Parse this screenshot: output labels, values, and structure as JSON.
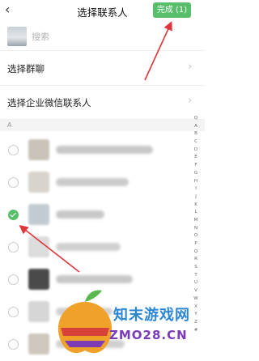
{
  "header": {
    "back_glyph": "‹",
    "title": "选择联系人",
    "done_label": "完成 (1)"
  },
  "search": {
    "placeholder": "搜索"
  },
  "menu": [
    {
      "label": "选择群聊",
      "chevron": "›"
    },
    {
      "label": "选择企业微信联系人",
      "chevron": "›"
    }
  ],
  "section": {
    "letter": "A"
  },
  "contacts": [
    {
      "checked": false
    },
    {
      "checked": false
    },
    {
      "checked": true
    },
    {
      "checked": false
    },
    {
      "checked": false
    },
    {
      "checked": false
    },
    {
      "checked": false
    }
  ],
  "index_letters": [
    "Q",
    "A",
    "B",
    "C",
    "D",
    "E",
    "F",
    "G",
    "H",
    "I",
    "J",
    "K",
    "L",
    "M",
    "N",
    "O",
    "P",
    "Q",
    "R",
    "S",
    "T",
    "U",
    "V",
    "W",
    "X",
    "Y",
    "Z",
    "#"
  ],
  "watermark": {
    "line1": "知末游戏网",
    "line2": "ZMO28.CN"
  },
  "colors": {
    "accent": "#57be6a",
    "annotation": "#e0353a"
  }
}
